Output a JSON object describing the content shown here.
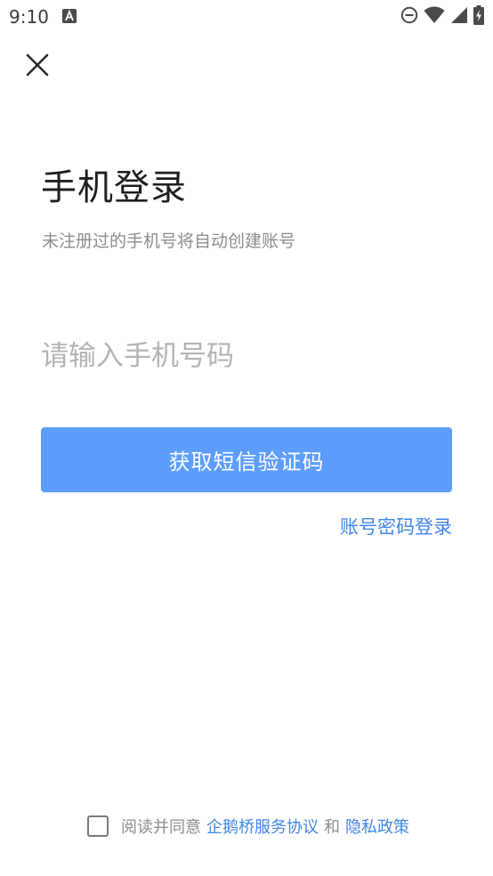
{
  "status_bar": {
    "time": "9:10",
    "icons": [
      "a-notification-icon",
      "do-not-disturb-icon",
      "wifi-icon",
      "cell-signal-icon",
      "battery-charging-icon"
    ]
  },
  "header": {
    "close_icon": "close-icon"
  },
  "main": {
    "title": "手机登录",
    "subtitle": "未注册过的手机号将自动创建账号",
    "phone_input": {
      "value": "",
      "placeholder": "请输入手机号码"
    },
    "sms_button_label": "获取短信验证码",
    "password_login_label": "账号密码登录"
  },
  "footer": {
    "checkbox_checked": false,
    "agree_prefix": "阅读并同意",
    "service_agreement_label": "企鹅桥服务协议",
    "and_text": "和",
    "privacy_policy_label": "隐私政策"
  },
  "colors": {
    "primary_button": "#5c9dff",
    "link": "#3f86e8",
    "title_text": "#1e1e1e",
    "secondary_text": "#8c8c8c",
    "placeholder_text": "#b3b3b3"
  }
}
